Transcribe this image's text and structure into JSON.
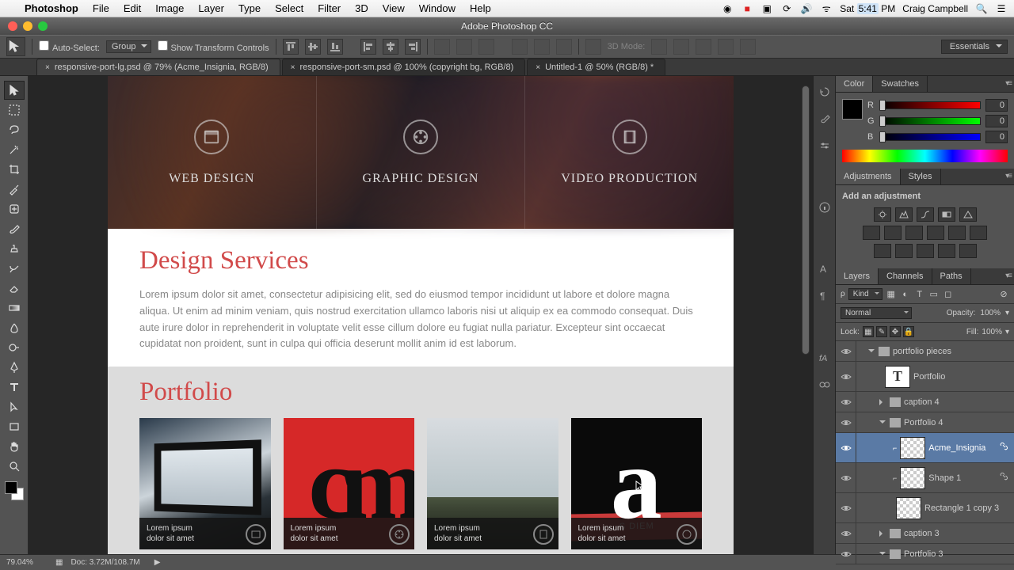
{
  "menubar": {
    "app": "Photoshop",
    "items": [
      "File",
      "Edit",
      "Image",
      "Layer",
      "Type",
      "Select",
      "Filter",
      "3D",
      "View",
      "Window",
      "Help"
    ],
    "clock": "Sat 5:41 PM",
    "user": "Craig Campbell"
  },
  "window": {
    "title": "Adobe Photoshop CC"
  },
  "options": {
    "auto_select": "Auto-Select:",
    "group": "Group",
    "show_transform": "Show Transform Controls",
    "mode3d": "3D Mode:",
    "workspace": "Essentials"
  },
  "tabs": [
    {
      "label": "responsive-port-lg.psd @ 79% (Acme_Insignia, RGB/8)",
      "active": true
    },
    {
      "label": "responsive-port-sm.psd @ 100% (copyright bg, RGB/8)",
      "active": false
    },
    {
      "label": "Untitled-1 @ 50% (RGB/8) *",
      "active": false
    }
  ],
  "canvas": {
    "hero": [
      "WEB DESIGN",
      "GRAPHIC DESIGN",
      "VIDEO PRODUCTION"
    ],
    "design_title": "Design Services",
    "design_body": "Lorem ipsum dolor sit amet, consectetur adipisicing elit, sed do eiusmod tempor incididunt ut labore et dolore magna aliqua. Ut enim ad minim veniam, quis nostrud exercitation ullamco laboris nisi ut aliquip ex ea commodo consequat. Duis aute irure dolor in reprehenderit in voluptate velit esse cillum dolore eu fugiat nulla pariatur. Excepteur sint occaecat cupidatat non proident, sunt in culpa qui officia deserunt mollit anim id est laborum.",
    "portfolio_title": "Portfolio",
    "portfolio_caption": "Lorem ipsum\ndolor sit amet",
    "ribbon": "S DIEM"
  },
  "panels": {
    "color_tab": "Color",
    "swatches_tab": "Swatches",
    "rgb": {
      "r_label": "R",
      "g_label": "G",
      "b_label": "B",
      "r": "0",
      "g": "0",
      "b": "0"
    },
    "adj_tab": "Adjustments",
    "styles_tab": "Styles",
    "adj_hint": "Add an adjustment",
    "layers_tab": "Layers",
    "channels_tab": "Channels",
    "paths_tab": "Paths",
    "kind": "Kind",
    "blend": "Normal",
    "opacity_label": "Opacity:",
    "opacity": "100%",
    "lock_label": "Lock:",
    "fill_label": "Fill:",
    "fill": "100%",
    "tree": {
      "group_top": "portfolio pieces",
      "portfolio_text": "Portfolio",
      "caption4": "caption 4",
      "portfolio4": "Portfolio 4",
      "acme": "Acme_Insignia",
      "shape1": "Shape 1",
      "rect": "Rectangle 1 copy 3",
      "caption3": "caption 3",
      "portfolio3": "Portfolio 3"
    }
  },
  "status": {
    "zoom": "79.04%",
    "doc": "Doc: 3.72M/108.7M"
  }
}
